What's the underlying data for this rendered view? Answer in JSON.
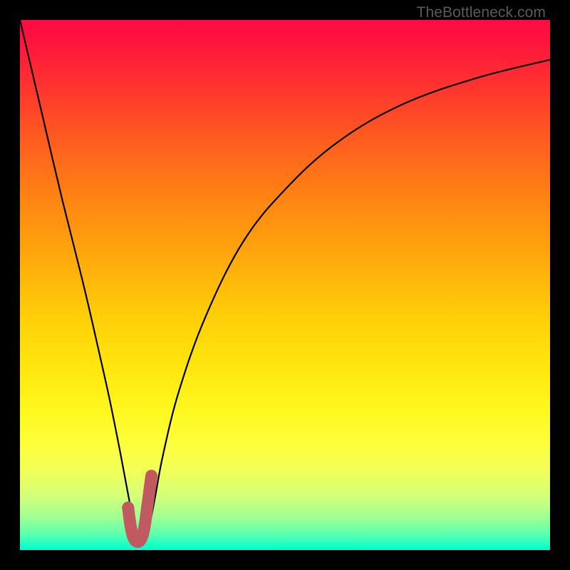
{
  "watermark": "TheBottleneck.com",
  "colors": {
    "background": "#000000",
    "gradient_top": "#ff0b44",
    "gradient_mid": "#ffe80e",
    "gradient_bottom": "#00ffd0",
    "curve": "#000000",
    "marker": "#c15a60"
  },
  "chart_data": {
    "type": "line",
    "title": "",
    "xlabel": "",
    "ylabel": "",
    "xlim": [
      0,
      100
    ],
    "ylim": [
      0,
      100
    ],
    "series": [
      {
        "name": "bottleneck-curve",
        "x": [
          0,
          4,
          8,
          12,
          15,
          17,
          19,
          20.5,
          21.5,
          22.5,
          23.5,
          24.5,
          25.5,
          27,
          30,
          35,
          42,
          50,
          60,
          72,
          86,
          100
        ],
        "values": [
          100,
          83,
          66,
          50,
          37,
          28,
          18,
          10,
          5,
          2,
          2,
          5,
          10,
          18,
          30,
          44,
          58,
          68,
          77,
          84,
          89,
          92.5
        ]
      }
    ],
    "markers": {
      "name": "valley-cap",
      "x": [
        20.4,
        20.8,
        21.2,
        21.6,
        22.0,
        22.4,
        22.8,
        23.2,
        23.6,
        24.0,
        24.4,
        24.8
      ],
      "values": [
        8.0,
        5.0,
        3.0,
        2.0,
        1.6,
        1.6,
        2.0,
        3.0,
        5.0,
        8.0,
        11.0,
        14.0
      ]
    }
  }
}
